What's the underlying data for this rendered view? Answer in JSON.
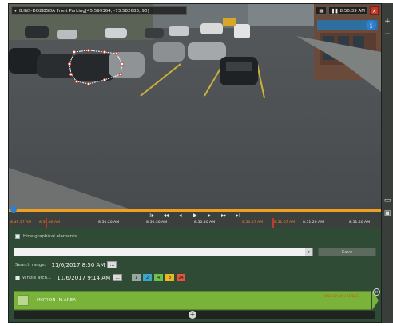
{
  "camera": {
    "title": "8.INS-DO2I8SDA Front Parking[45.599364, -73.582683, 90]",
    "time": "8:50:39 AM"
  },
  "timeline": {
    "times": [
      "8:49:57 AM",
      "8:50:02 AM",
      "8:50:20 AM",
      "8:50:30 AM",
      "8:50:40 AM",
      "8:50:47 AM",
      "8:51:07 AM",
      "8:51:20 AM",
      "8:51:40 AM"
    ],
    "controls": [
      "[▸",
      "◂◂",
      "◂",
      "▶",
      "▸",
      "▸▸",
      "▸]"
    ]
  },
  "panel": {
    "hide_label": "Hide graphical elements",
    "save_label": "Save",
    "search_range_label": "Search range:",
    "search_range_value": "11/6/2017  8:50 AM",
    "whole_label": "Whole arch...",
    "whole_value": "11/6/2017  9:14 AM",
    "dots_label": "...",
    "chips": [
      {
        "label": "1",
        "color": "#9aa6a0"
      },
      {
        "label": "2",
        "color": "#3aa7c9"
      },
      {
        "label": "4",
        "color": "#6cc24a"
      },
      {
        "label": "8",
        "color": "#e9b923"
      },
      {
        "label": "24",
        "color": "#e0553d"
      }
    ],
    "result_label": "MOTION IN AREA",
    "result_tag": "8:50:37 AM / 11/6/17"
  },
  "icons": {
    "dropdown": "chevron-down-icon",
    "info": "info-icon",
    "close": "close-icon",
    "plus": "plus-icon",
    "minus": "minus-icon",
    "add": "add-icon"
  }
}
